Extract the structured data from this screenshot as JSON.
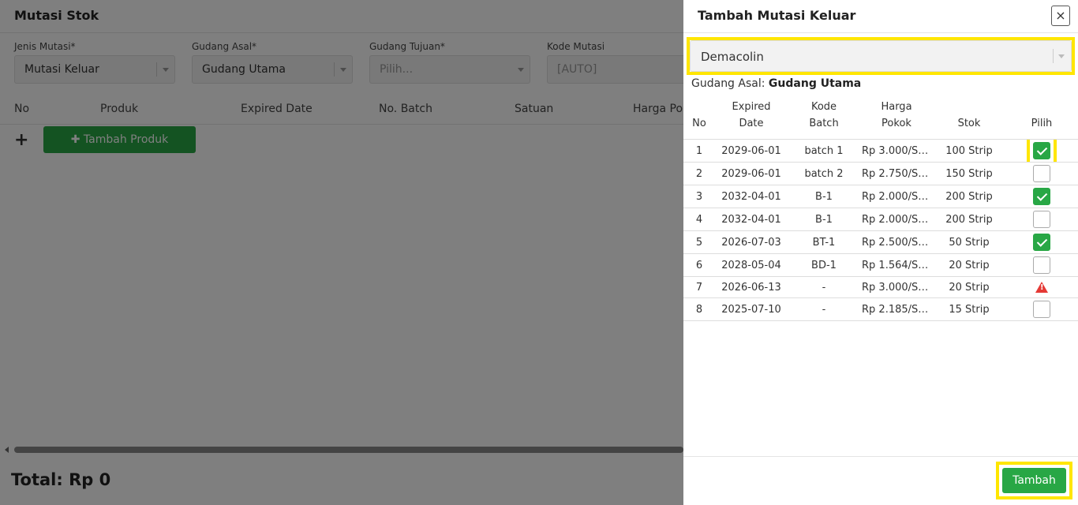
{
  "page": {
    "title": "Mutasi Stok",
    "fields": [
      {
        "label": "Jenis Mutasi*",
        "value": "Mutasi Keluar"
      },
      {
        "label": "Gudang Asal*",
        "value": "Gudang Utama"
      },
      {
        "label": "Gudang Tujuan*",
        "value": "Pilih..."
      },
      {
        "label": "Kode Mutasi",
        "value": "[AUTO]"
      }
    ],
    "columns": [
      "No",
      "Produk",
      "Expired Date",
      "No. Batch",
      "Satuan",
      "Harga Po"
    ],
    "add_icon": "+",
    "add_product_label": "✚ Tambah Produk",
    "total": "Total: Rp 0"
  },
  "drawer": {
    "title": "Tambah Mutasi Keluar",
    "close_label": "×",
    "product_value": "Demacolin",
    "origin_label": "Gudang Asal:",
    "origin_value": "Gudang Utama",
    "headers": {
      "no": "No",
      "expired_1": "Expired",
      "expired_2": "Date",
      "batch_1": "Kode",
      "batch_2": "Batch",
      "price_1": "Harga",
      "price_2": "Pokok",
      "stock": "Stok",
      "select": "Pilih"
    },
    "rows": [
      {
        "no": "1",
        "expired": "2029-06-01",
        "batch": "batch 1",
        "price": "Rp 3.000/St...",
        "stock": "100 Strip",
        "state": "checked"
      },
      {
        "no": "2",
        "expired": "2029-06-01",
        "batch": "batch 2",
        "price": "Rp 2.750/St...",
        "stock": "150 Strip",
        "state": "unchecked"
      },
      {
        "no": "3",
        "expired": "2032-04-01",
        "batch": "B-1",
        "price": "Rp 2.000/St...",
        "stock": "200 Strip",
        "state": "checked"
      },
      {
        "no": "4",
        "expired": "2032-04-01",
        "batch": "B-1",
        "price": "Rp 2.000/St...",
        "stock": "200 Strip",
        "state": "unchecked"
      },
      {
        "no": "5",
        "expired": "2026-07-03",
        "batch": "BT-1",
        "price": "Rp 2.500/St...",
        "stock": "50 Strip",
        "state": "checked"
      },
      {
        "no": "6",
        "expired": "2028-05-04",
        "batch": "BD-1",
        "price": "Rp 1.564/St...",
        "stock": "20 Strip",
        "state": "unchecked"
      },
      {
        "no": "7",
        "expired": "2026-06-13",
        "batch": "-",
        "price": "Rp 3.000/St...",
        "stock": "20 Strip",
        "state": "warning"
      },
      {
        "no": "8",
        "expired": "2025-07-10",
        "batch": "-",
        "price": "Rp 2.185/St...",
        "stock": "15 Strip",
        "state": "unchecked"
      }
    ],
    "submit_label": "Tambah"
  },
  "colors": {
    "accent_green": "#28a745",
    "highlight_yellow": "#ffe600",
    "warning_red": "#e53935"
  }
}
